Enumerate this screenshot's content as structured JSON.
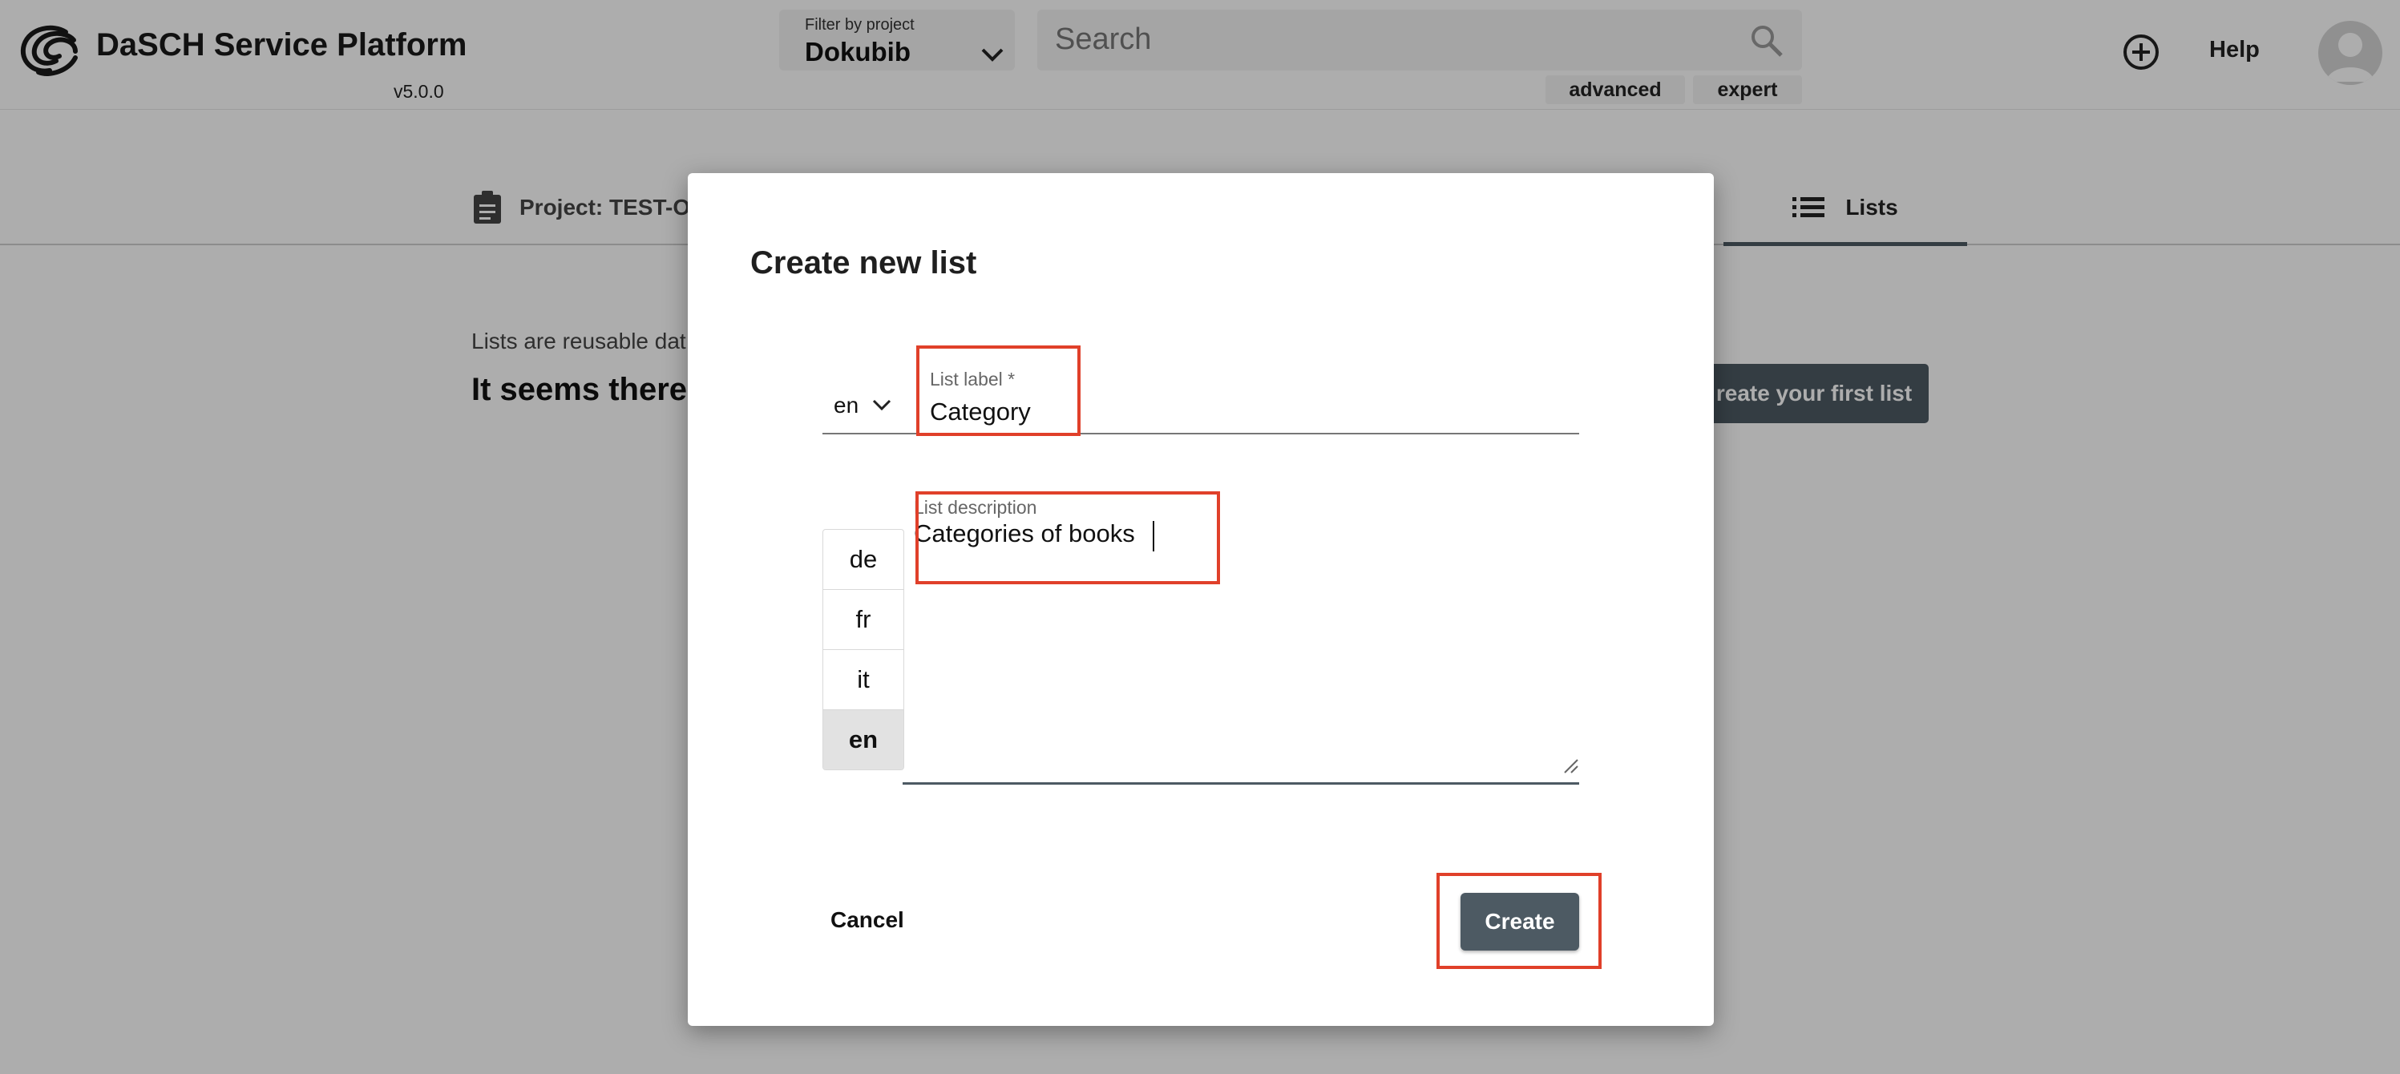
{
  "header": {
    "app_title": "DaSCH Service Platform",
    "version": "v5.0.0",
    "filter": {
      "label": "Filter by project",
      "value": "Dokubib"
    },
    "search": {
      "placeholder": "Search"
    },
    "search_modes": [
      "advanced",
      "expert"
    ],
    "help": "Help"
  },
  "page": {
    "tab_project": "Project: TEST-ON",
    "tab_lists": "Lists",
    "lists_description": "Lists are reusable dat",
    "empty_message": "It seems there's",
    "first_list_button": "reate your first list"
  },
  "dialog": {
    "title": "Create new list",
    "label_field": {
      "caption": "List label *",
      "value": "Category",
      "language": "en"
    },
    "description_field": {
      "caption": "List description",
      "value": "Categories of books"
    },
    "languages": [
      "de",
      "fr",
      "it",
      "en"
    ],
    "active_language": "en",
    "cancel_label": "Cancel",
    "create_label": "Create"
  },
  "colors": {
    "accent": "#4d5a63",
    "highlight": "#e0402a"
  }
}
